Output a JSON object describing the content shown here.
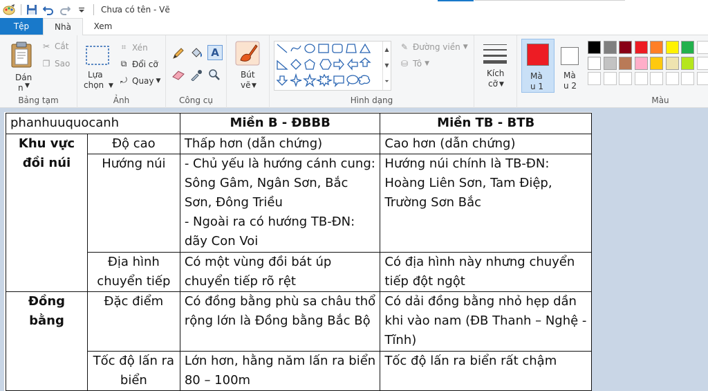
{
  "window": {
    "title": "Chưa có tên - Vẽ"
  },
  "tabs": [
    "Tệp",
    "Nhà",
    "Xem"
  ],
  "ribbon": {
    "clipboard": {
      "paste": "Dán",
      "paste_sub": "n",
      "cut": "Cắt",
      "copy": "Sao",
      "label": "Bảng tạm"
    },
    "image": {
      "select": "Lựa",
      "select_sub": "chọn",
      "crop": "Xén",
      "resize": "Đổi cỡ",
      "rotate": "Quay",
      "label": "Ảnh"
    },
    "tools": {
      "label": "Công cụ"
    },
    "brush": {
      "line1": "Bút",
      "line2": "vẽ"
    },
    "shapes": {
      "outline": "Đường viền",
      "fill": "Tô",
      "label": "Hình dạng"
    },
    "size": {
      "line1": "Kích",
      "line2": "cỡ"
    },
    "color1": {
      "line1": "Mà",
      "line2": "u 1",
      "value": "#ed1c24"
    },
    "color2": {
      "line1": "Mà",
      "line2": "u 2",
      "value": "#ffffff"
    },
    "colors": {
      "label": "Màu",
      "row1": [
        "#000000",
        "#7f7f7f",
        "#880015",
        "#ed1c24",
        "#ff7f27",
        "#fff200",
        "#22b14c"
      ],
      "row2": [
        "#ffffff",
        "#c3c3c3",
        "#b97a57",
        "#ffaec9",
        "#ffc90e",
        "#efe4b0",
        "#b5e61d"
      ]
    }
  },
  "table": {
    "signature": "phanhuuquocanh",
    "header_b": "Miền B - ĐBBB",
    "header_tb": "Miền TB - BTB",
    "region1": "Khu vực đồi núi",
    "region2": "Đồng bằng",
    "rows": [
      {
        "label": "Độ cao",
        "b": "Thấp hơn (dẫn chứng)",
        "tb": "Cao hơn (dẫn chứng)"
      },
      {
        "label": "Hướng núi",
        "b": "- Chủ yếu là hướng cánh cung: Sông Gâm, Ngân Sơn, Bắc Sơn, Đông Triều\n- Ngoài ra có hướng TB-ĐN: dãy Con Voi",
        "tb": "Hướng núi chính là TB-ĐN: Hoàng Liên Sơn, Tam Điệp, Trường Sơn Bắc"
      },
      {
        "label": "Địa hình chuyển tiếp",
        "b": "Có một vùng đồi bát úp chuyển tiếp rõ rệt",
        "tb": "Có địa hình này nhưng chuyển tiếp đột ngột"
      },
      {
        "label": "Đặc điểm",
        "b": "Có đồng bằng phù sa châu thổ rộng lớn là Đồng bằng Bắc Bộ",
        "tb": "Có dải đồng bằng nhỏ hẹp dần khi vào nam (ĐB Thanh – Nghệ - Tĩnh)"
      },
      {
        "label": "Tốc độ lấn ra biển",
        "b": "Lớn hơn, hằng năm lấn ra biển 80 – 100m",
        "tb": "Tốc độ lấn ra biển rất chậm"
      }
    ]
  }
}
